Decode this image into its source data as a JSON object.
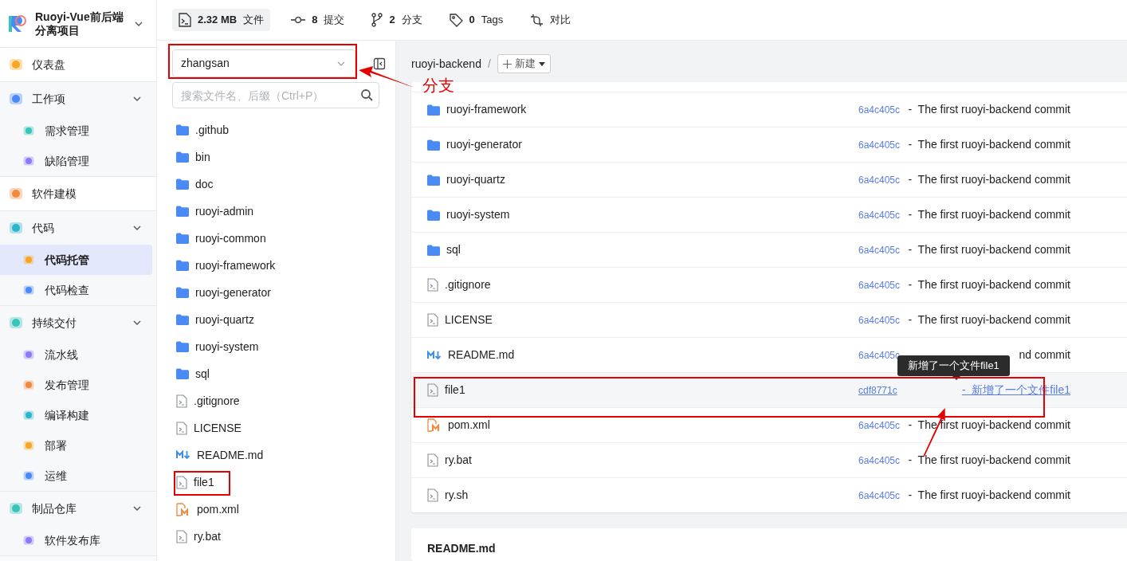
{
  "sidebar": {
    "title": "Ruoyi-Vue前后端分离项目",
    "groups": [
      {
        "label": "仪表盘"
      },
      {
        "label": "工作项",
        "expanded": true,
        "children": [
          {
            "label": "需求管理",
            "selected": false
          },
          {
            "label": "缺陷管理",
            "selected": false
          }
        ]
      },
      {
        "label": "软件建模"
      },
      {
        "label": "代码",
        "expanded": true,
        "children": [
          {
            "label": "代码托管",
            "selected": true
          },
          {
            "label": "代码检查",
            "selected": false
          }
        ]
      },
      {
        "label": "持续交付",
        "expanded": true,
        "children": [
          {
            "label": "流水线",
            "selected": false
          },
          {
            "label": "发布管理",
            "selected": false
          },
          {
            "label": "编译构建",
            "selected": false
          },
          {
            "label": "部署",
            "selected": false
          },
          {
            "label": "运维",
            "selected": false
          }
        ]
      },
      {
        "label": "制品仓库",
        "expanded": true,
        "children": [
          {
            "label": "软件发布库",
            "selected": false
          }
        ]
      }
    ]
  },
  "stats": [
    {
      "kind": "files",
      "value": "2.32 MB",
      "label": "文件",
      "selected": true
    },
    {
      "kind": "commits",
      "value": "8",
      "label": "提交",
      "selected": false
    },
    {
      "kind": "branches",
      "value": "2",
      "label": "分支",
      "selected": false
    },
    {
      "kind": "tags",
      "value": "0",
      "label": "Tags",
      "selected": false
    },
    {
      "kind": "compare",
      "label": "对比",
      "selected": false
    }
  ],
  "repo_panel": {
    "branch": "zhangsan",
    "search": {
      "placeholder": "搜索文件名、后缀（Ctrl+P）"
    },
    "tree": [
      {
        "name": ".github",
        "kind": "folder"
      },
      {
        "name": "bin",
        "kind": "folder"
      },
      {
        "name": "doc",
        "kind": "folder"
      },
      {
        "name": "ruoyi-admin",
        "kind": "folder"
      },
      {
        "name": "ruoyi-common",
        "kind": "folder"
      },
      {
        "name": "ruoyi-framework",
        "kind": "folder"
      },
      {
        "name": "ruoyi-generator",
        "kind": "folder"
      },
      {
        "name": "ruoyi-quartz",
        "kind": "folder"
      },
      {
        "name": "ruoyi-system",
        "kind": "folder"
      },
      {
        "name": "sql",
        "kind": "folder"
      },
      {
        "name": ".gitignore",
        "kind": "file"
      },
      {
        "name": "LICENSE",
        "kind": "file"
      },
      {
        "name": "README.md",
        "kind": "markdown"
      },
      {
        "name": "file1",
        "kind": "file"
      },
      {
        "name": "pom.xml",
        "kind": "maven"
      },
      {
        "name": "ry.bat",
        "kind": "file"
      }
    ]
  },
  "content": {
    "breadcrumb": "ruoyi-backend",
    "separator": "/",
    "new_button": "新建",
    "rows": [
      {
        "name": "ruoyi-framework",
        "kind": "folder",
        "hash": "6a4c405c",
        "message": "-  The first ruoyi-backend commit",
        "hovered": false
      },
      {
        "name": "ruoyi-generator",
        "kind": "folder",
        "hash": "6a4c405c",
        "message": "-  The first ruoyi-backend commit",
        "hovered": false
      },
      {
        "name": "ruoyi-quartz",
        "kind": "folder",
        "hash": "6a4c405c",
        "message": "-  The first ruoyi-backend commit",
        "hovered": false
      },
      {
        "name": "ruoyi-system",
        "kind": "folder",
        "hash": "6a4c405c",
        "message": "-  The first ruoyi-backend commit",
        "hovered": false
      },
      {
        "name": "sql",
        "kind": "folder",
        "hash": "6a4c405c",
        "message": "-  The first ruoyi-backend commit",
        "hovered": false
      },
      {
        "name": ".gitignore",
        "kind": "file",
        "hash": "6a4c405c",
        "message": "-  The first ruoyi-backend commit",
        "hovered": false
      },
      {
        "name": "LICENSE",
        "kind": "file",
        "hash": "6a4c405c",
        "message": "-  The first ruoyi-backend commit",
        "hovered": false
      },
      {
        "name": "README.md",
        "kind": "markdown",
        "hash": "6a4c405c",
        "message": "nd commit",
        "hovered": false
      },
      {
        "name": "file1",
        "kind": "file",
        "hash": "cdf8771c",
        "message": "-  新增了一个文件file1",
        "hovered": true
      },
      {
        "name": "pom.xml",
        "kind": "maven",
        "hash": "6a4c405c",
        "message": "-  The first ruoyi-backend commit",
        "hovered": false
      },
      {
        "name": "ry.bat",
        "kind": "file",
        "hash": "6a4c405c",
        "message": "-  The first ruoyi-backend commit",
        "hovered": false
      },
      {
        "name": "ry.sh",
        "kind": "file",
        "hash": "6a4c405c",
        "message": "-  The first ruoyi-backend commit",
        "hovered": false
      }
    ],
    "tooltip": "新增了一个文件file1",
    "readme_title": "README.md"
  },
  "annotation": {
    "label": "分支"
  }
}
